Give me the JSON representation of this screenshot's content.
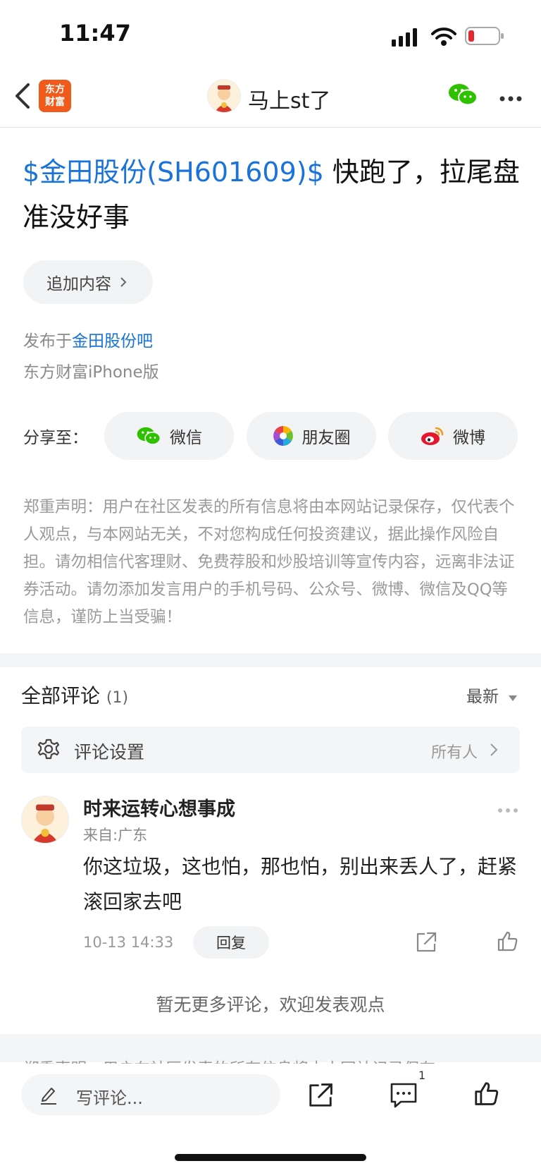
{
  "status_bar": {
    "time": "11:47"
  },
  "nav": {
    "app_logo_line1": "东方",
    "app_logo_line2": "财富",
    "author": "马上st了"
  },
  "post": {
    "stock_tag": "$金田股份(SH601609)$",
    "title_rest": " 快跑了，拉尾盘准没好事",
    "add_content": "追加内容",
    "published_prefix": "发布于",
    "forum": "金田股份吧",
    "device": "东方财富iPhone版"
  },
  "share": {
    "label": "分享至：",
    "wechat": "微信",
    "moments": "朋友圈",
    "weibo": "微博"
  },
  "disclaimer": "郑重声明：用户在社区发表的所有信息将由本网站记录保存，仅代表个人观点，与本网站无关，不对您构成任何投资建议，据此操作风险自担。请勿相信代客理财、免费荐股和炒股培训等宣传内容，远离非法证券活动。请勿添加发言用户的手机号码、公众号、微博、微信及QQ等信息，谨防上当受骗！",
  "comments": {
    "header": "全部评论",
    "count": "(1)",
    "sort": "最新",
    "settings_label": "评论设置",
    "settings_value": "所有人",
    "items": [
      {
        "user": "时来运转心想事成",
        "from": "来自:广东",
        "text": "你这垃圾，这也怕，那也怕，别出来丢人了，赶紧滚回家去吧",
        "time": "10-13 14:33",
        "reply": "回复"
      }
    ],
    "no_more": "暂无更多评论，欢迎发表观点"
  },
  "disclaimer_repeat_cut": "郑重声明：用户在社区发表的所有信息将由本网站记录保存，",
  "bottom": {
    "placeholder": "写评论...",
    "comment_badge": "1"
  },
  "colors": {
    "link": "#1a73d9",
    "brand": "#f05a1a",
    "wechat": "#2dc100",
    "weibo": "#e6162d"
  }
}
